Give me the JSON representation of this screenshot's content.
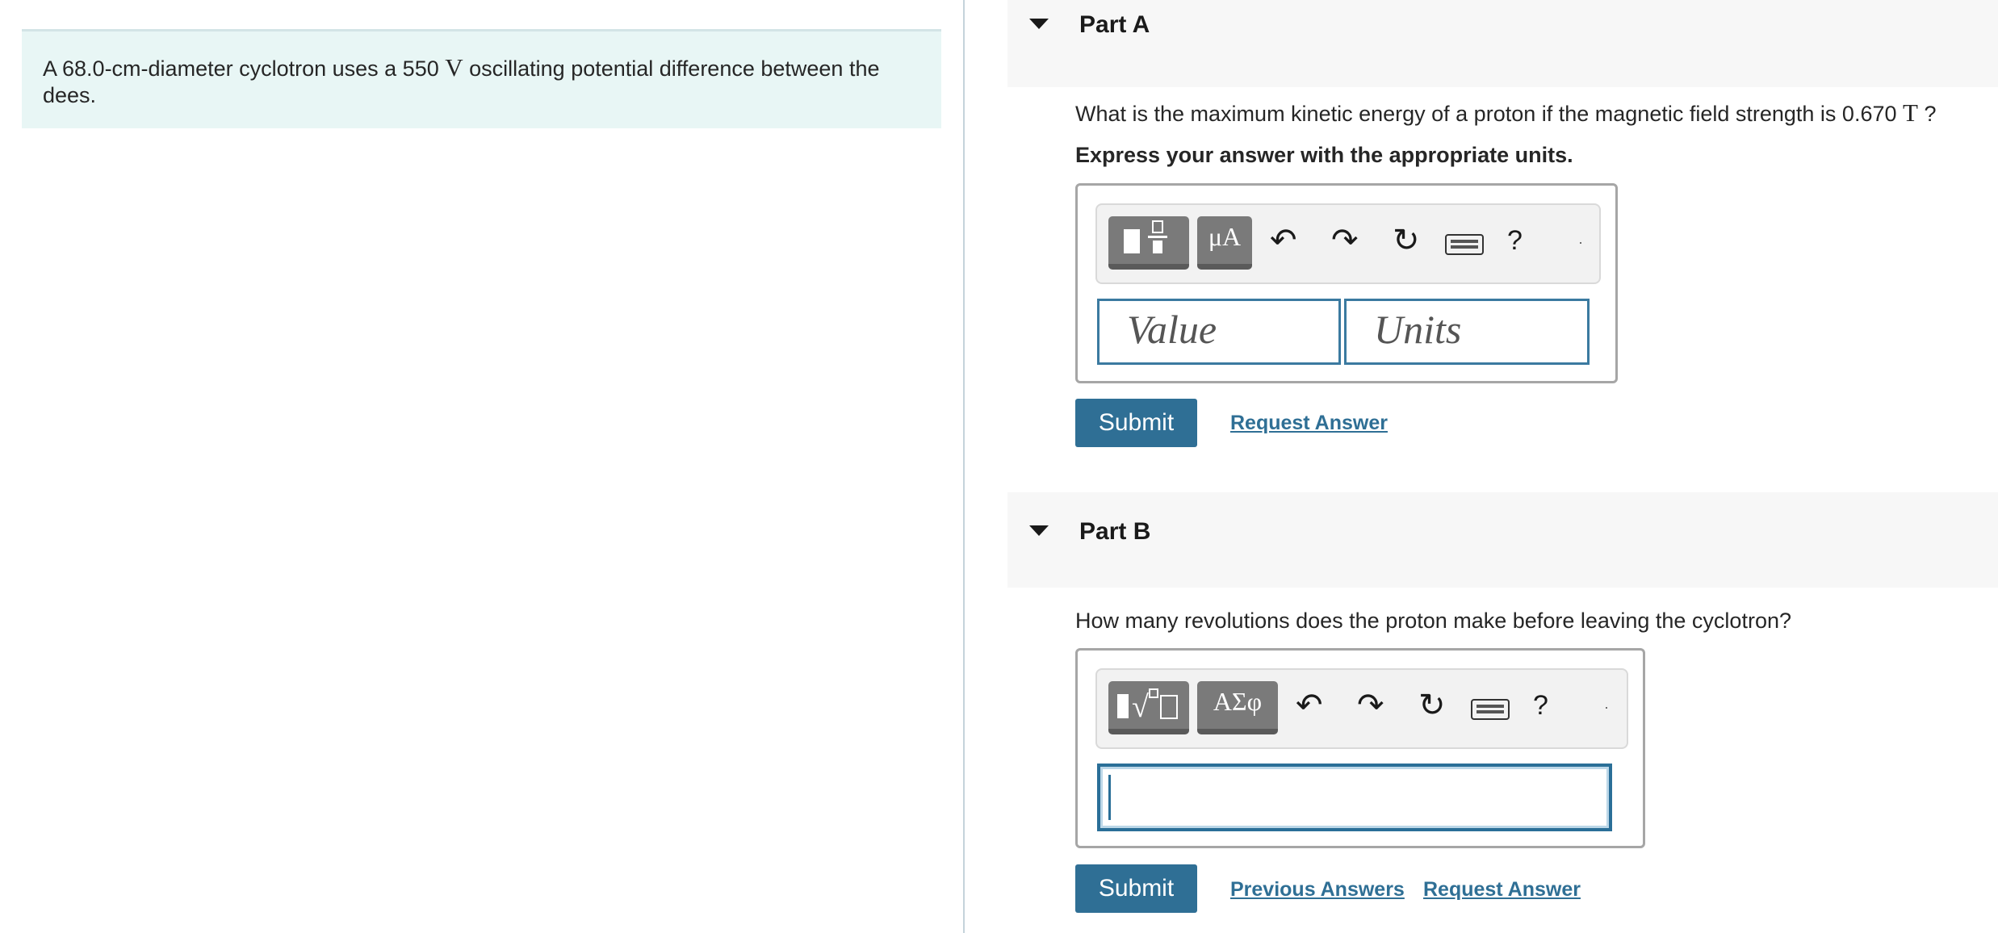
{
  "problem": {
    "text_before": "A 68.0-cm-diameter cyclotron uses a 550 ",
    "unit": "V",
    "text_after": " oscillating potential difference between the dees."
  },
  "partA": {
    "title": "Part A",
    "question_before": "What is the maximum kinetic energy of a proton if the magnetic field strength is 0.670 ",
    "question_unit": "T",
    "question_after": " ?",
    "instruction": "Express your answer with the appropriate units.",
    "toolbar": {
      "template_btn": "",
      "greek_btn": "μA",
      "help": "?",
      "more": "·"
    },
    "value_placeholder": "Value",
    "units_placeholder": "Units",
    "submit_label": "Submit",
    "request_answer_label": "Request Answer"
  },
  "partB": {
    "title": "Part B",
    "question": "How many revolutions does the proton make before leaving the cyclotron?",
    "toolbar": {
      "template_btn": "√",
      "greek_btn": "ΑΣφ",
      "help": "?",
      "more": "·"
    },
    "answer_value": "",
    "submit_label": "Submit",
    "previous_answers_label": "Previous Answers",
    "request_answer_label": "Request Answer"
  },
  "colors": {
    "accent": "#2f6f95",
    "problem_bg": "#e8f6f5",
    "header_bg": "#f7f7f7"
  }
}
